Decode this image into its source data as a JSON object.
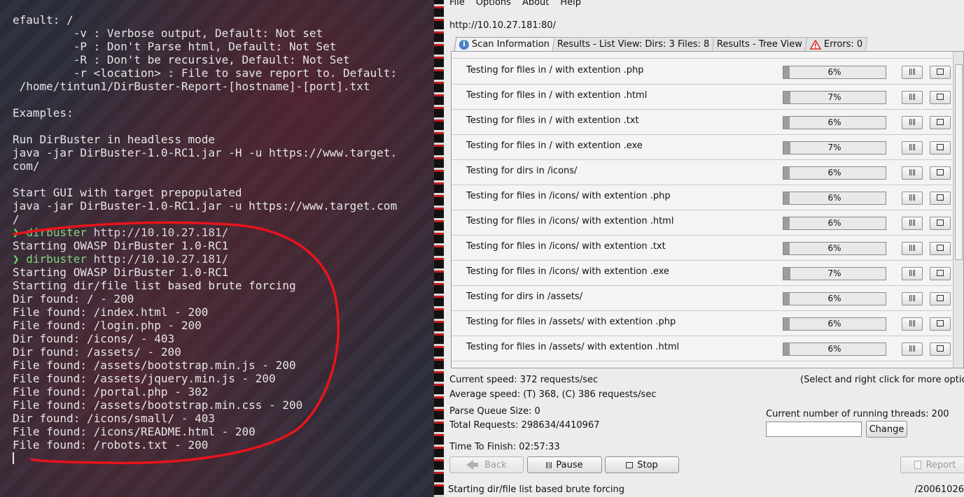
{
  "terminal": {
    "help_lines": [
      "efault: /",
      "         -v : Verbose output, Default: Not set",
      "         -P : Don't Parse html, Default: Not Set",
      "         -R : Don't be recursive, Default: Not Set",
      "         -r <location> : File to save report to. Default:",
      " /home/tintun1/DirBuster-Report-[hostname]-[port].txt",
      "",
      "Examples:",
      "",
      "Run DirBuster in headless mode",
      "java -jar DirBuster-1.0-RC1.jar -H -u https://www.target.",
      "com/",
      "",
      "Start GUI with target prepopulated",
      "java -jar DirBuster-1.0-RC1.jar -u https://www.target.com",
      "/"
    ],
    "prompt_symbol": "❯",
    "command_name": "dirbuster",
    "command_arg": "http://10.10.27.181/",
    "output_lines_1": [
      "Starting OWASP DirBuster 1.0-RC1"
    ],
    "output_lines_2": [
      "Starting OWASP DirBuster 1.0-RC1",
      "Starting dir/file list based brute forcing",
      "Dir found: / - 200",
      "File found: /index.html - 200",
      "File found: /login.php - 200",
      "Dir found: /icons/ - 403",
      "Dir found: /assets/ - 200",
      "File found: /assets/bootstrap.min.js - 200",
      "File found: /assets/jquery.min.js - 200",
      "File found: /portal.php - 302",
      "File found: /assets/bootstrap.min.css - 200",
      "Dir found: /icons/small/ - 403",
      "File found: /icons/README.html - 200",
      "File found: /robots.txt - 200"
    ],
    "annotation_color": "#e8141b"
  },
  "dirbuster": {
    "menu": [
      "File",
      "Options",
      "About",
      "Help"
    ],
    "target_url": "http://10.10.27.181:80/",
    "tabs": [
      {
        "label": "Scan Information",
        "icon": "info-icon"
      },
      {
        "label": "Results - List View: Dirs: 3 Files: 8"
      },
      {
        "label": "Results - Tree View"
      },
      {
        "label": "Errors: 0",
        "icon": "warning-icon"
      }
    ],
    "scan_rows": [
      {
        "label": "Testing for files in / with extention .php",
        "percent_text": "6%",
        "progress": 0.06
      },
      {
        "label": "Testing for files in / with extention .html",
        "percent_text": "7%",
        "progress": 0.07
      },
      {
        "label": "Testing for files in / with extention .txt",
        "percent_text": "6%",
        "progress": 0.06
      },
      {
        "label": "Testing for files in / with extention .exe",
        "percent_text": "7%",
        "progress": 0.07
      },
      {
        "label": "Testing for dirs in /icons/",
        "percent_text": "6%",
        "progress": 0.06
      },
      {
        "label": "Testing for files in /icons/ with extention .php",
        "percent_text": "6%",
        "progress": 0.06
      },
      {
        "label": "Testing for files in /icons/ with extention .html",
        "percent_text": "6%",
        "progress": 0.06
      },
      {
        "label": "Testing for files in /icons/ with extention .txt",
        "percent_text": "6%",
        "progress": 0.06
      },
      {
        "label": "Testing for files in /icons/ with extention .exe",
        "percent_text": "7%",
        "progress": 0.07
      },
      {
        "label": "Testing for dirs in /assets/",
        "percent_text": "6%",
        "progress": 0.06
      },
      {
        "label": "Testing for files in /assets/ with extention .php",
        "percent_text": "6%",
        "progress": 0.06
      },
      {
        "label": "Testing for files in /assets/ with extention .html",
        "percent_text": "6%",
        "progress": 0.06
      }
    ],
    "current_speed": "Current speed: 372 requests/sec",
    "select_hint": "(Select and right click for more options)",
    "average_speed": "Average speed: (T) 368, (C) 386 requests/sec",
    "parse_queue": "Parse Queue Size: 0",
    "running_threads": "Current number of running threads: 200",
    "total_requests": "Total Requests: 298634/4410967",
    "threads_input_value": "",
    "change_button": "Change",
    "time_to_finish": "Time To Finish: 02:57:33",
    "back_button": "Back",
    "pause_button": "Pause",
    "stop_button": "Stop",
    "report_button": "Report",
    "status_left": "Starting dir/file list based brute forcing",
    "status_right": "/20061026"
  }
}
